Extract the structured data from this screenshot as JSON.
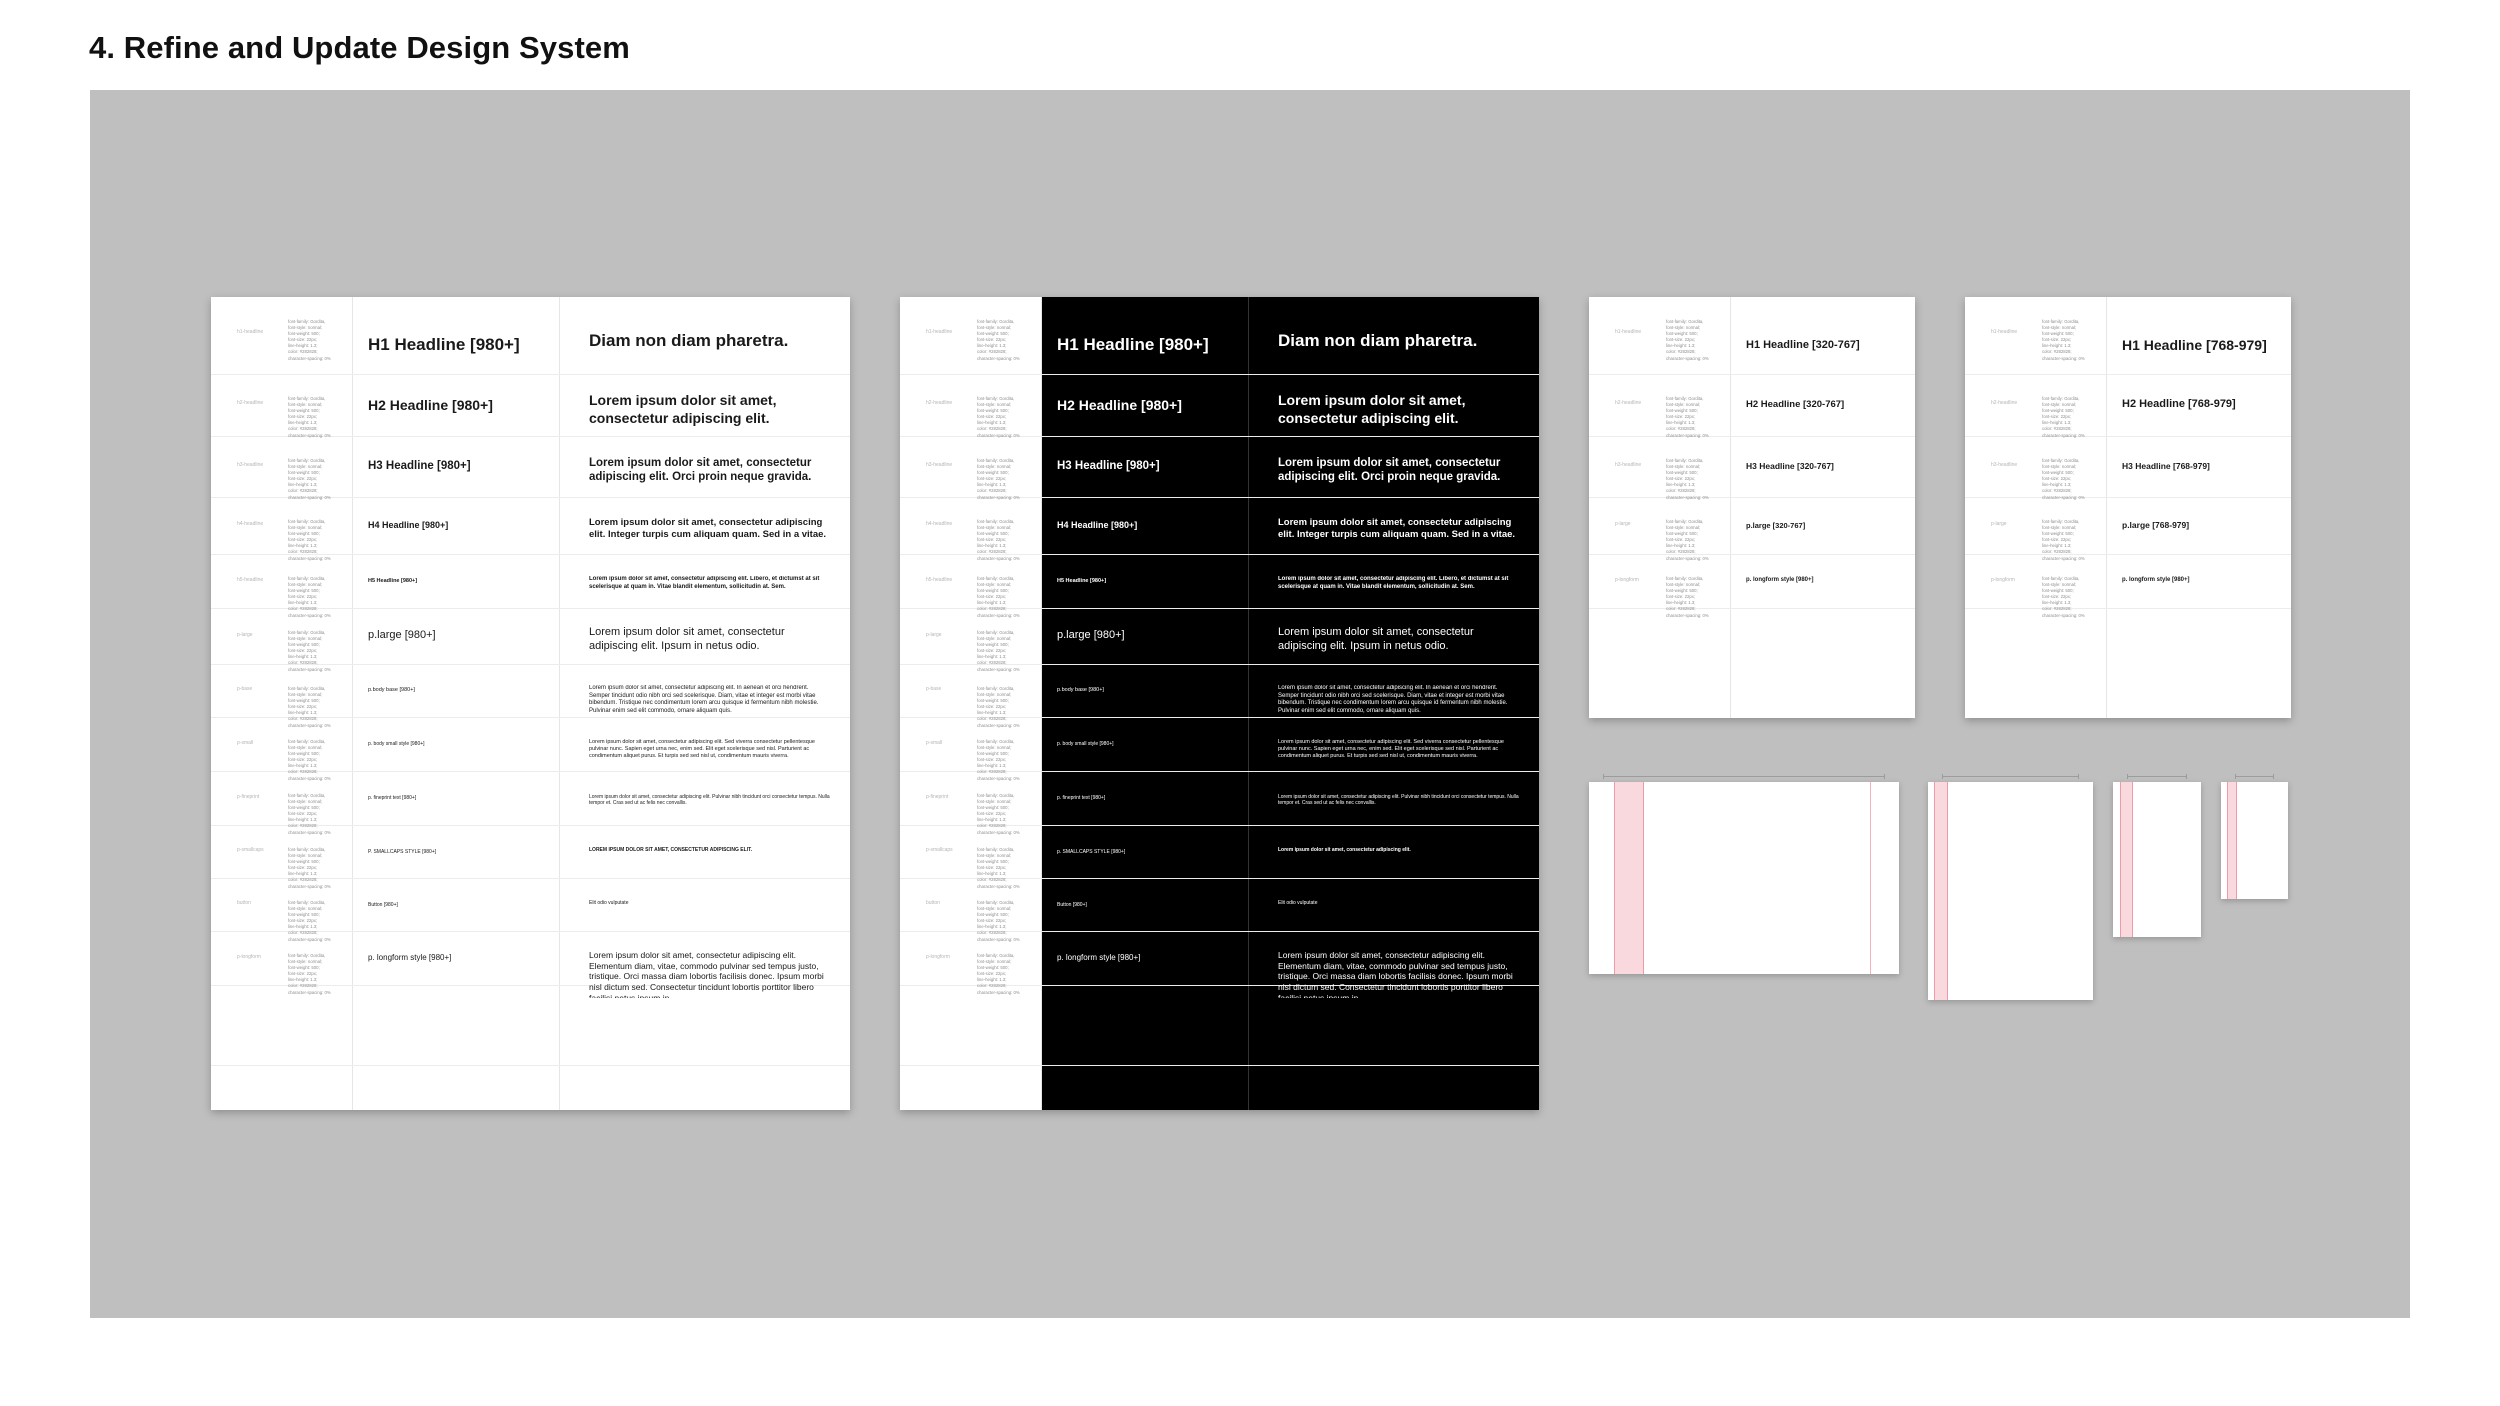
{
  "title": "4. Refine and Update Design System",
  "spec_text": "font-family: Gordita,\nfont-style: normal;\nfont-weight: 500;\nfont-size: 22px;\nline-height: 1.3;\ncolor: #282828;\ncharacter-spacing: 0%",
  "sheets": [
    {
      "id": "light-980",
      "theme": "light",
      "rows": [
        {
          "label": "h1-headline",
          "name": "H1 Headline [980+]",
          "sample": "Diam non diam pharetra."
        },
        {
          "label": "h2-headline",
          "name": "H2 Headline [980+]",
          "sample": "Lorem ipsum dolor sit amet, consectetur adipiscing elit."
        },
        {
          "label": "h3-headline",
          "name": "H3 Headline [980+]",
          "sample": "Lorem ipsum dolor sit amet, consectetur adipiscing elit. Orci proin neque gravida."
        },
        {
          "label": "h4-headline",
          "name": "H4 Headline [980+]",
          "sample": "Lorem ipsum dolor sit amet, consectetur adipiscing elit. Integer turpis cum aliquam quam. Sed in a vitae."
        },
        {
          "label": "h5-headline",
          "name": "H5 Headline [980+]",
          "sample": "Lorem ipsum dolor sit amet, consectetur adipiscing elit. Libero, et dictumst at sit scelerisque at quam in. Vitae blandit elementum, sollicitudin at. Sem."
        },
        {
          "label": "p-large",
          "name": "p.large [980+]",
          "sample": "Lorem ipsum dolor sit amet, consectetur adipiscing elit. Ipsum in netus odio."
        },
        {
          "label": "p-base",
          "name": "p.body base [980+]",
          "sample": "Lorem ipsum dolor sit amet, consectetur adipiscing elit. In aenean et orci hendrerit. Semper tincidunt odio nibh orci sed scelerisque. Diam, vitae et integer est morbi vitae bibendum. Tristique nec condimentum lorem arcu quisque id fermentum nibh molestie. Pulvinar enim sed elit commodo, ornare aliquam quis."
        },
        {
          "label": "p-small",
          "name": "p. body small style [980+]",
          "sample": "Lorem ipsum dolor sit amet, consectetur adipiscing elit. Sed viverra consectetur pellentesque pulvinar nunc. Sapien eget urna nec, enim sed. Elit eget scelerisque sed nisl. Parturient ac condimentum aliquet purus. Et turpis sed sed nisl ut, condimentum mauris viverra."
        },
        {
          "label": "p-fineprint",
          "name": "p. fineprint text [980+]",
          "sample": "Lorem ipsum dolor sit amet, consectetur adipiscing elit. Pulvinar nibh tincidunt orci consectetur tempus. Nulla tempor et. Cras sed ut ac felis nec convallis."
        },
        {
          "label": "p-smallcaps",
          "name": "P. SMALLCAPS STYLE [980+]",
          "sample": "LOREM IPSUM DOLOR SIT AMET, CONSECTETUR ADIPISCING ELIT."
        },
        {
          "label": "button",
          "name": "Button [980+]",
          "sample": "Elit odio vulputate"
        },
        {
          "label": "p-longform",
          "name": "p. longform style [980+]",
          "sample": "Lorem ipsum dolor sit amet, consectetur adipiscing elit. Elementum diam, vitae, commodo pulvinar sed tempus justo, tristique. Orci massa diam lobortis facilisis donec. Ipsum morbi nisl dictum sed. Consectetur tincidunt lobortis porttitor libero facilisi netus ipsum in."
        }
      ]
    },
    {
      "id": "dark-980",
      "theme": "dark",
      "rows": [
        {
          "label": "h1-headline",
          "name": "H1 Headline [980+]",
          "sample": "Diam non diam pharetra."
        },
        {
          "label": "h2-headline",
          "name": "H2 Headline [980+]",
          "sample": "Lorem ipsum dolor sit amet, consectetur adipiscing elit."
        },
        {
          "label": "h3-headline",
          "name": "H3 Headline [980+]",
          "sample": "Lorem ipsum dolor sit amet, consectetur adipiscing elit. Orci proin neque gravida."
        },
        {
          "label": "h4-headline",
          "name": "H4 Headline [980+]",
          "sample": "Lorem ipsum dolor sit amet, consectetur adipiscing elit. Integer turpis cum aliquam quam. Sed in a vitae."
        },
        {
          "label": "h5-headline",
          "name": "H5 Headline [980+]",
          "sample": "Lorem ipsum dolor sit amet, consectetur adipiscing elit. Libero, et dictumst at sit scelerisque at quam in. Vitae blandit elementum, sollicitudin at. Sem."
        },
        {
          "label": "p-large",
          "name": "p.large [980+]",
          "sample": "Lorem ipsum dolor sit amet, consectetur adipiscing elit. Ipsum in netus odio."
        },
        {
          "label": "p-base",
          "name": "p.body base [980+]",
          "sample": "Lorem ipsum dolor sit amet, consectetur adipiscing elit. In aenean et orci hendrerit. Semper tincidunt odio nibh orci sed scelerisque. Diam, vitae et integer est morbi vitae bibendum. Tristique nec condimentum lorem arcu quisque id fermentum nibh molestie. Pulvinar enim sed elit commodo, ornare aliquam quis."
        },
        {
          "label": "p-small",
          "name": "p. body small style [980+]",
          "sample": "Lorem ipsum dolor sit amet, consectetur adipiscing elit. Sed viverra consectetur pellentesque pulvinar nunc. Sapien eget urna nec, enim sed. Elit eget scelerisque sed nisl. Parturient ac condimentum aliquet purus. Et turpis sed sed nisl ut, condimentum mauris viverra."
        },
        {
          "label": "p-fineprint",
          "name": "p. fineprint text [980+]",
          "sample": "Lorem ipsum dolor sit amet, consectetur adipiscing elit. Pulvinar nibh tincidunt orci consectetur tempus. Nulla tempor et. Cras sed ut ac felis nec convallis."
        },
        {
          "label": "p-smallcaps",
          "name": "p. SMALLCAPS STYLE [980+]",
          "sample": "Lorem ipsum dolor sit amet, consectetur adipiscing elit."
        },
        {
          "label": "button",
          "name": "Button [980+]",
          "sample": "Elit odio vulputate"
        },
        {
          "label": "p-longform",
          "name": "p. longform style [980+]",
          "sample": "Lorem ipsum dolor sit amet, consectetur adipiscing elit. Elementum diam, vitae, commodo pulvinar sed tempus justo, tristique. Orci massa diam lobortis facilisis donec. Ipsum morbi nisl dictum sed. Consectetur tincidunt lobortis porttitor libero facilisi netus ipsum in."
        }
      ]
    },
    {
      "id": "light-320",
      "theme": "light",
      "rows": [
        {
          "label": "h1-headline",
          "name": "H1 Headline [320-767]"
        },
        {
          "label": "h2-headline",
          "name": "H2 Headline [320-767]"
        },
        {
          "label": "h3-headline",
          "name": "H3 Headline [320-767]"
        },
        {
          "label": "p-large",
          "name": "p.large [320-767]"
        },
        {
          "label": "p-longform",
          "name": "p. longform style [980+]"
        }
      ]
    },
    {
      "id": "light-768",
      "theme": "light",
      "rows": [
        {
          "label": "h1-headline",
          "name": "H1 Headline [768-979]"
        },
        {
          "label": "h2-headline",
          "name": "H2 Headline [768-979]"
        },
        {
          "label": "h3-headline",
          "name": "H3 Headline [768-979]"
        },
        {
          "label": "p-large",
          "name": "p.large [768-979]"
        },
        {
          "label": "p-longform",
          "name": "p. longform style [980+]"
        }
      ]
    }
  ],
  "grid_frames": [
    {
      "id": "grid-980"
    },
    {
      "id": "grid-768"
    },
    {
      "id": "grid-480"
    },
    {
      "id": "grid-320"
    }
  ],
  "colors": {
    "canvas": "#bfbfbf",
    "sheet": "#ffffff",
    "dark_pane": "#000000",
    "grid_column": "#f9d9dd",
    "grid_line": "#ef9aa6"
  }
}
